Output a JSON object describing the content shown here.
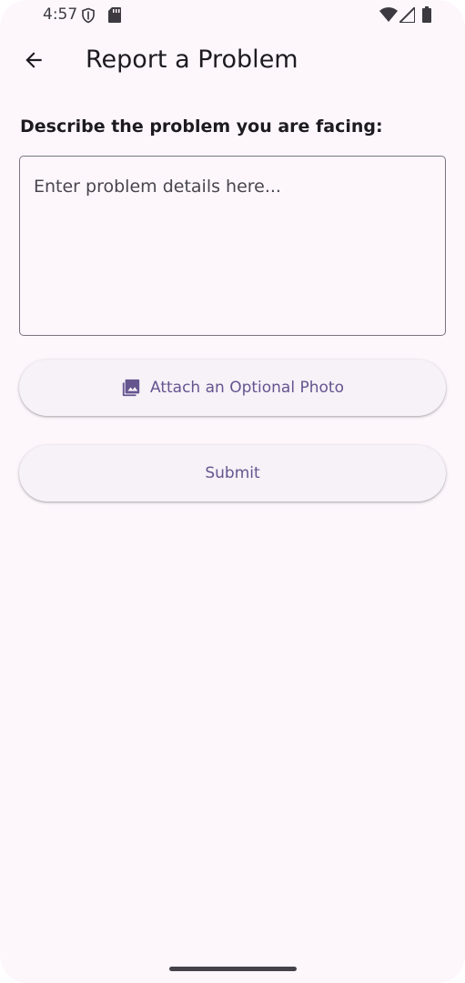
{
  "status_bar": {
    "time": "4:57",
    "icons": [
      "shield-icon",
      "sd-card-icon",
      "wifi-icon",
      "signal-icon",
      "battery-icon"
    ]
  },
  "app_bar": {
    "back_icon": "arrow-back-icon",
    "title": "Report a Problem"
  },
  "form": {
    "prompt_label": "Describe the problem you are facing:",
    "details_placeholder": "Enter problem details here...",
    "details_value": "",
    "attach_icon": "photo-library-icon",
    "attach_label": "Attach an Optional Photo",
    "submit_label": "Submit"
  },
  "colors": {
    "background": "#fdf7fc",
    "accent": "#65558f",
    "button_bg": "#f7f1f8",
    "text_primary": "#1d1b20",
    "outline": "#79747e"
  }
}
